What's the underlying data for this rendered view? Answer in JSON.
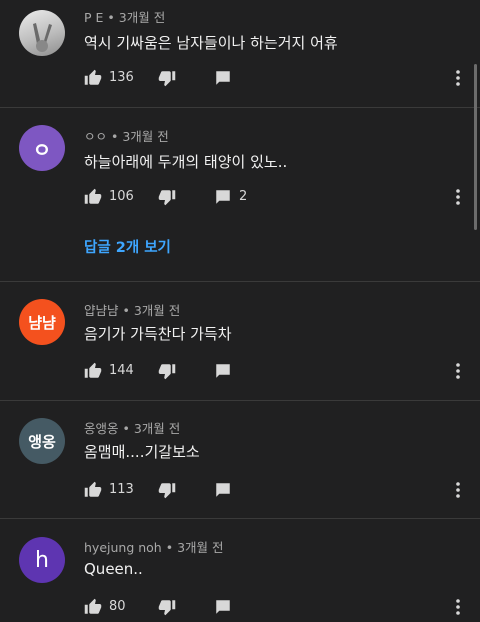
{
  "comments": [
    {
      "author": "P E",
      "time": "3개월 전",
      "text": "역시 기싸움은 남자들이나 하는거지 어휴",
      "likes": "136",
      "reply_count": "",
      "avatar_text": "",
      "avatar_color": "#c8c8c8",
      "avatar_type": "photo"
    },
    {
      "author": "ㅇㅇ",
      "time": "3개월 전",
      "text": "하늘아래에 두개의 태양이 있노..",
      "likes": "106",
      "reply_count": "2",
      "avatar_text": "ㅇ",
      "avatar_color": "#7e57c2",
      "avatar_type": "letter"
    },
    {
      "author": "얍냠냠",
      "time": "3개월 전",
      "text": "음기가 가득찬다 가득차",
      "likes": "144",
      "reply_count": "",
      "avatar_text": "냠냠",
      "avatar_color": "#f4511e",
      "avatar_type": "letter"
    },
    {
      "author": "옹앵옹",
      "time": "3개월 전",
      "text": "옴맴매....기갈보소",
      "likes": "113",
      "reply_count": "",
      "avatar_text": "앵옹",
      "avatar_color": "#455a64",
      "avatar_type": "letter"
    },
    {
      "author": "hyejung noh",
      "time": "3개월 전",
      "text": "Queen..",
      "likes": "80",
      "reply_count": "",
      "avatar_text": "h",
      "avatar_color": "#5e35b1",
      "avatar_type": "letter"
    }
  ],
  "replies_link": "답글 2개 보기",
  "separator": "•",
  "icons": {
    "like": "thumbs-up-icon",
    "dislike": "thumbs-down-icon",
    "reply": "reply-icon",
    "more": "more-vert-icon"
  }
}
